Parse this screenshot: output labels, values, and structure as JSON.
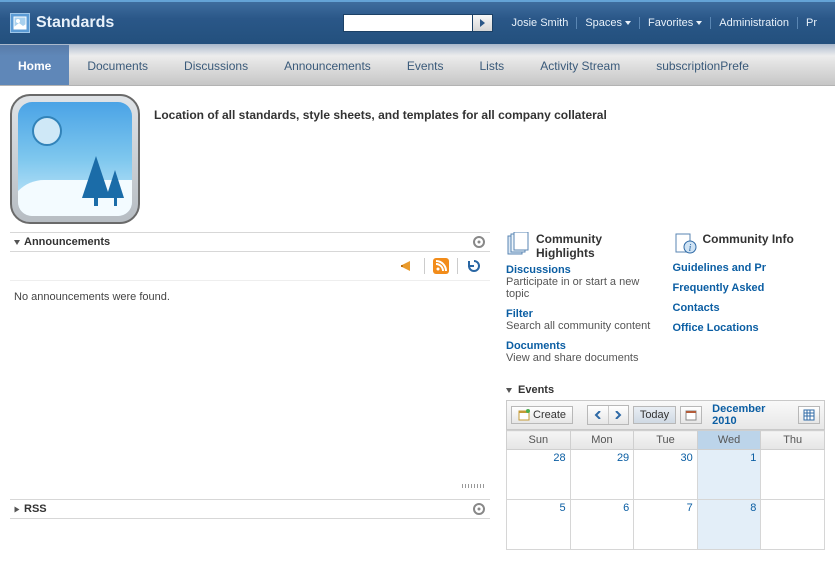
{
  "header": {
    "app_title": "Standards",
    "user": "Josie Smith",
    "links": {
      "spaces": "Spaces",
      "favorites": "Favorites",
      "administration": "Administration",
      "preferences": "Pr"
    },
    "search_placeholder": ""
  },
  "tabs": [
    {
      "label": "Home",
      "active": true
    },
    {
      "label": "Documents",
      "active": false
    },
    {
      "label": "Discussions",
      "active": false
    },
    {
      "label": "Announcements",
      "active": false
    },
    {
      "label": "Events",
      "active": false
    },
    {
      "label": "Lists",
      "active": false
    },
    {
      "label": "Activity Stream",
      "active": false
    },
    {
      "label": "subscriptionPrefe",
      "active": false
    }
  ],
  "info": {
    "description": "Location of all standards, style sheets, and templates for all company collateral"
  },
  "left": {
    "announcements": {
      "title": "Announcements",
      "empty": "No announcements were found."
    },
    "rss": {
      "title": "RSS"
    }
  },
  "right": {
    "community_highlights": {
      "title": "Community Highlights",
      "items": [
        {
          "link": "Discussions",
          "sub": "Participate in or start a new topic"
        },
        {
          "link": "Filter",
          "sub": "Search all community content"
        },
        {
          "link": "Documents",
          "sub": "View and share documents"
        }
      ]
    },
    "community_info": {
      "title": "Community Info",
      "items": [
        {
          "link": "Guidelines and Pr"
        },
        {
          "link": "Frequently Asked"
        },
        {
          "link": "Contacts"
        },
        {
          "link": "Office Locations"
        }
      ]
    },
    "events": {
      "title": "Events",
      "create_label": "Create",
      "today_label": "Today",
      "month_label": "December 2010",
      "dow": [
        "Sun",
        "Mon",
        "Tue",
        "Wed",
        "Thu"
      ],
      "today_col_index": 3,
      "weeks": [
        [
          "28",
          "29",
          "30",
          "1",
          ""
        ],
        [
          "5",
          "6",
          "7",
          "8",
          ""
        ]
      ]
    }
  }
}
